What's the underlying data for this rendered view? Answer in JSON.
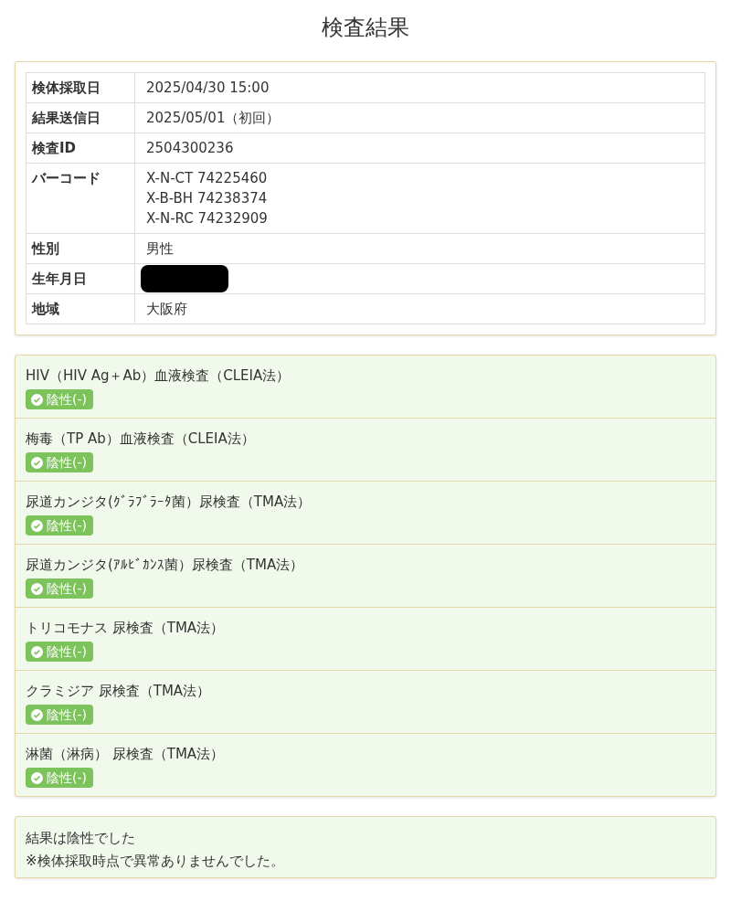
{
  "title": "検査結果",
  "info": {
    "rows": [
      {
        "label": "検体採取日",
        "values": [
          "2025/04/30 15:00"
        ]
      },
      {
        "label": "結果送信日",
        "values": [
          "2025/05/01（初回）"
        ]
      },
      {
        "label": "検査ID",
        "values": [
          "2504300236"
        ]
      },
      {
        "label": "バーコード",
        "values": [
          "X-N-CT 74225460",
          "X-B-BH 74238374",
          "X-N-RC 74232909"
        ]
      },
      {
        "label": "性別",
        "values": [
          "男性"
        ]
      },
      {
        "label": "生年月日",
        "redacted": true
      },
      {
        "label": "地域",
        "values": [
          "大阪府"
        ]
      }
    ]
  },
  "tests": [
    {
      "name": "HIV（HIV Ag＋Ab）血液検査（CLEIA法）",
      "result": {
        "label": "陰性(-)",
        "kind": "negative"
      }
    },
    {
      "name": "梅毒（TP Ab）血液検査（CLEIA法）",
      "result": {
        "label": "陰性(-)",
        "kind": "negative"
      }
    },
    {
      "name": "尿道カンジタ(ｸﾞﾗﾌﾞﾗｰﾀ菌）尿検査（TMA法）",
      "result": {
        "label": "陰性(-)",
        "kind": "negative"
      }
    },
    {
      "name": "尿道カンジタ(ｱﾙﾋﾞｶﾝｽ菌）尿検査（TMA法）",
      "result": {
        "label": "陰性(-)",
        "kind": "negative"
      }
    },
    {
      "name": "トリコモナス 尿検査（TMA法）",
      "result": {
        "label": "陰性(-)",
        "kind": "negative"
      }
    },
    {
      "name": "クラミジア 尿検査（TMA法）",
      "result": {
        "label": "陰性(-)",
        "kind": "negative"
      }
    },
    {
      "name": "淋菌（淋病） 尿検査（TMA法）",
      "result": {
        "label": "陰性(-)",
        "kind": "negative"
      }
    }
  ],
  "summary": [
    "結果は陰性でした",
    "※検体採取時点で異常ありませんでした。"
  ]
}
